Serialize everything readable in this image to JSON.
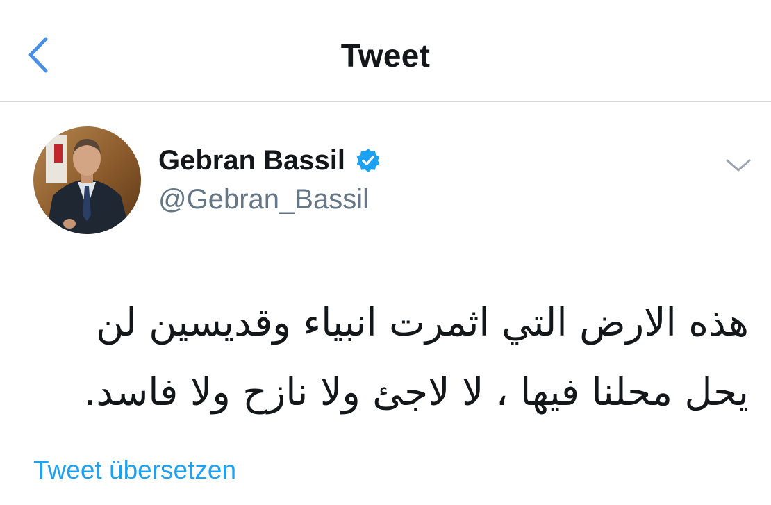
{
  "nav": {
    "title": "Tweet",
    "back_icon": "chevron-left-icon"
  },
  "tweet": {
    "author_name": "Gebran Bassil",
    "verified": true,
    "handle": "@Gebran_Bassil",
    "menu_icon": "chevron-down-icon",
    "text": "هذه الارض التي اثمرت انبياء وقديسين لن يحل محلنا فيها ، لا لاجئ ولا نازح ولا فاسد.",
    "translate_label": "Tweet übersetzen"
  },
  "colors": {
    "accent": "#1da1f2",
    "back_arrow": "#4a90e2",
    "text_primary": "#14171a",
    "text_secondary": "#657786",
    "divider": "#d6d9dc"
  }
}
